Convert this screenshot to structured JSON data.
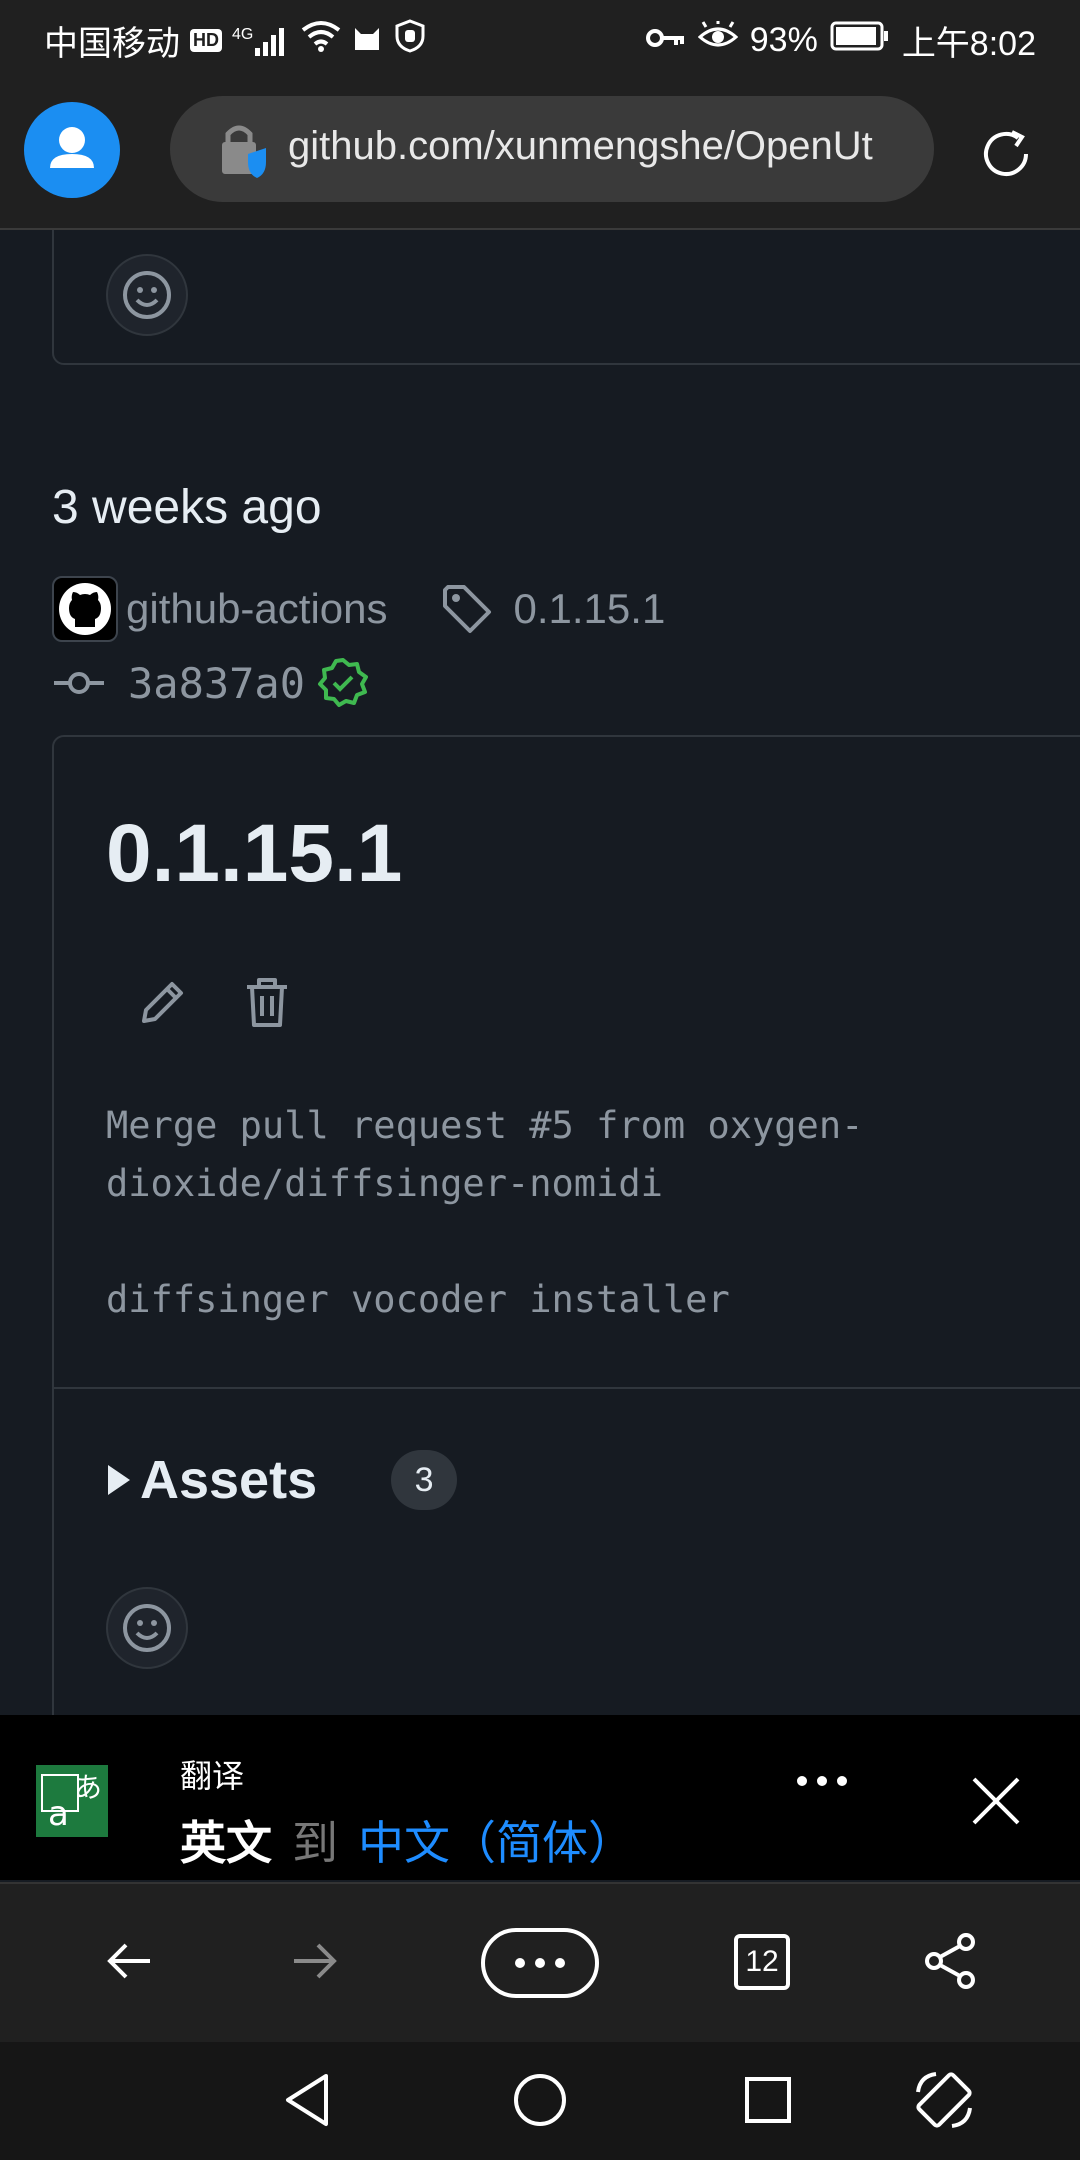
{
  "status_bar": {
    "carrier": "中国移动",
    "hd_badge": "HD",
    "network": "4G",
    "battery": "93%",
    "time": "上午8:02"
  },
  "browser": {
    "url": "github.com/xunmengshe/OpenUt"
  },
  "release": {
    "date": "3 weeks ago",
    "author": "github-actions",
    "tag": "0.1.15.1",
    "commit": "3a837a0",
    "title": "0.1.15.1",
    "body": "Merge pull request #5 from oxygen-\ndioxide/diffsinger-nomidi\n\ndiffsinger vocoder installer",
    "assets_label": "Assets",
    "assets_count": "3"
  },
  "translate_bar": {
    "title": "翻译",
    "from_lang": "英文",
    "to_word": "到",
    "to_lang": "中文（简体）"
  },
  "bottom_nav": {
    "tab_count": "12"
  },
  "colors": {
    "page_bg": "#161b22",
    "border": "#30363d",
    "text": "#e6edf3",
    "muted": "#8d96a0",
    "verified_green": "#3fb950",
    "accent_blue": "#1e8cff"
  }
}
